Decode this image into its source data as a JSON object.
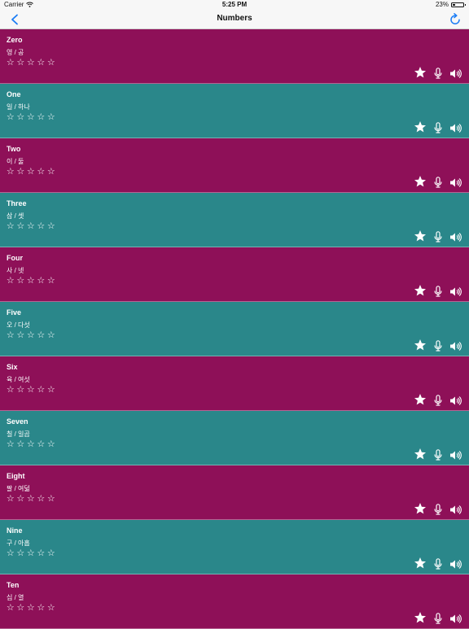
{
  "status_bar": {
    "carrier": "Carrier",
    "time": "5:25 PM",
    "battery": "23%"
  },
  "nav": {
    "title": "Numbers"
  },
  "colors": {
    "magenta": "#8e1058",
    "teal": "#2a878a",
    "accent": "#1a7cf5"
  },
  "items": [
    {
      "word": "Zero",
      "translation": "영 / 공",
      "rating": 0,
      "color": "magenta"
    },
    {
      "word": "One",
      "translation": "일 / 하나",
      "rating": 0,
      "color": "teal"
    },
    {
      "word": "Two",
      "translation": "이 / 둘",
      "rating": 0,
      "color": "magenta"
    },
    {
      "word": "Three",
      "translation": "삼 / 셋",
      "rating": 0,
      "color": "teal"
    },
    {
      "word": "Four",
      "translation": "사 / 넷",
      "rating": 0,
      "color": "magenta"
    },
    {
      "word": "Five",
      "translation": "오 / 다섯",
      "rating": 0,
      "color": "teal"
    },
    {
      "word": "Six",
      "translation": "육 / 여섯",
      "rating": 0,
      "color": "magenta"
    },
    {
      "word": "Seven",
      "translation": "칠 / 일곱",
      "rating": 0,
      "color": "teal"
    },
    {
      "word": "Eight",
      "translation": "팔 / 여덟",
      "rating": 0,
      "color": "magenta"
    },
    {
      "word": "Nine",
      "translation": "구 / 아홉",
      "rating": 0,
      "color": "teal"
    },
    {
      "word": "Ten",
      "translation": "십 / 열",
      "rating": 0,
      "color": "magenta"
    }
  ],
  "icons": {
    "back": "chevron-left-icon",
    "refresh": "refresh-icon",
    "favorite": "star-icon",
    "record": "microphone-icon",
    "play": "speaker-icon"
  }
}
